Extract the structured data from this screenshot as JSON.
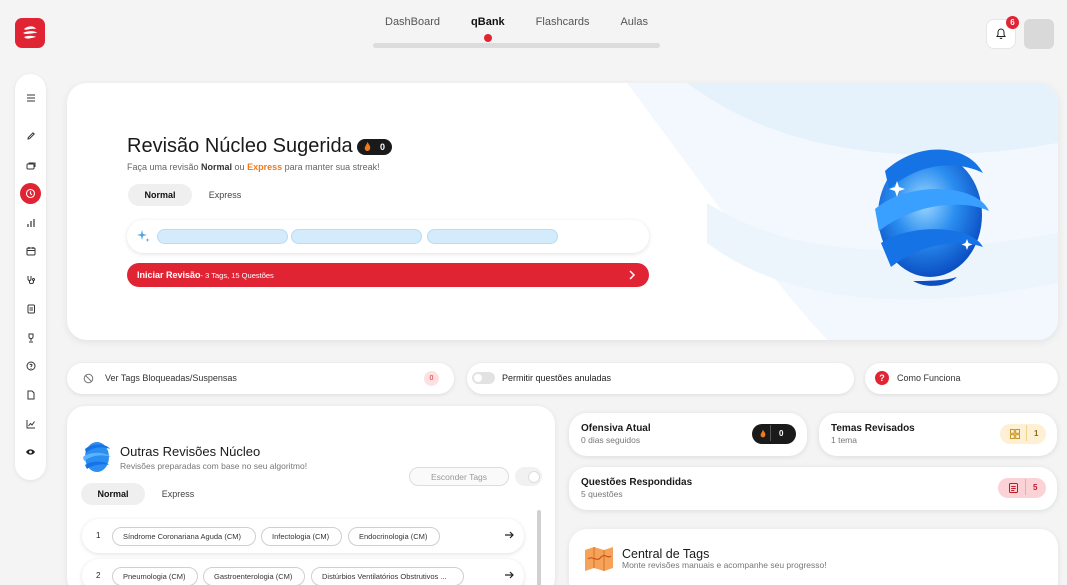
{
  "brand": {
    "color": "#e02434",
    "logo_icon": "spiral-logo-icon"
  },
  "topnav": {
    "tabs": [
      {
        "label": "DashBoard",
        "active": false
      },
      {
        "label": "qBank",
        "active": true
      },
      {
        "label": "Flashcards",
        "active": false
      },
      {
        "label": "Aulas",
        "active": false
      }
    ]
  },
  "header": {
    "notifications_count": "6"
  },
  "sidebar": {
    "items": [
      {
        "icon": "menu-icon"
      },
      {
        "icon": "pencil-icon"
      },
      {
        "icon": "stack-icon"
      },
      {
        "icon": "history-icon",
        "active": true
      },
      {
        "icon": "bar-chart-icon"
      },
      {
        "icon": "calendar-icon"
      },
      {
        "icon": "stethoscope-icon"
      },
      {
        "icon": "document-icon"
      },
      {
        "icon": "trophy-icon"
      },
      {
        "icon": "help-icon"
      },
      {
        "icon": "file-icon"
      },
      {
        "icon": "line-chart-icon"
      },
      {
        "icon": "eye-icon"
      }
    ]
  },
  "hero": {
    "title": "Revisão Núcleo Sugerida",
    "streak": "0",
    "subtitle_prefix": "Faça uma revisão ",
    "subtitle_normal": "Normal",
    "subtitle_mid": " ou ",
    "subtitle_express": "Express",
    "subtitle_suffix": " para manter sua streak!",
    "mode_normal": "Normal",
    "mode_express": "Express",
    "start_label": "Iniciar Revisão",
    "start_detail": "- 3 Tags, 15 Questões"
  },
  "options": {
    "blocked_label": "Ver Tags Bloqueadas/Suspensas",
    "blocked_count": "0",
    "annulled_label": "Permitir questões anuladas",
    "annulled_enabled": false,
    "how_label": "Como Funciona"
  },
  "outras": {
    "title": "Outras Revisões Núcleo",
    "subtitle": "Revisões preparadas com base no seu algoritmo!",
    "hide_tags": "Esconder Tags",
    "mode_normal": "Normal",
    "mode_express": "Express",
    "rows": [
      {
        "num": "1",
        "tags": [
          "Síndrome Coronariana Aguda (CM)",
          "Infectologia (CM)",
          "Endocrinologia (CM)"
        ]
      },
      {
        "num": "2",
        "tags": [
          "Pneumologia (CM)",
          "Gastroenterologia (CM)",
          "Distúrbios Ventilatórios Obstrutivos ..."
        ]
      }
    ]
  },
  "stats": {
    "ofensiva": {
      "title": "Ofensiva Atual",
      "sub": "0 dias seguidos",
      "value": "0"
    },
    "temas": {
      "title": "Temas Revisados",
      "sub": "1 tema",
      "value": "1"
    },
    "questoes": {
      "title": "Questões Respondidas",
      "sub": "5 questões",
      "value": "5"
    }
  },
  "central": {
    "title": "Central de Tags",
    "subtitle": "Monte revisões manuais e acompanhe seu progresso!"
  }
}
